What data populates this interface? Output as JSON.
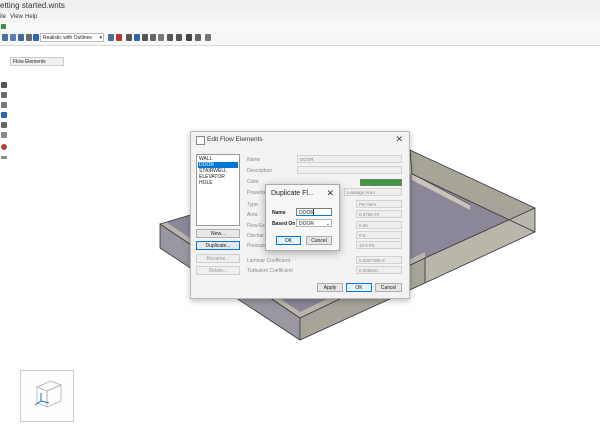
{
  "app": {
    "title": "etting started.wnts"
  },
  "menu": {
    "items": [
      "ile",
      "View",
      "Help"
    ]
  },
  "toolbar": {
    "render_mode": "Realistic with Outlines"
  },
  "panel": {
    "flow_elements_label": "Flow Elements"
  },
  "edit_dialog": {
    "title": "Edit Flow Elements",
    "list_items": [
      "WALL",
      "DOOR",
      "STAIRWELL",
      "ELEVATOR",
      "HOLE"
    ],
    "selected_index": 1,
    "buttons": {
      "new": "New...",
      "duplicate": "Duplicate...",
      "rename": "Rename...",
      "delete": "Delete..."
    },
    "props": {
      "name_label": "Name",
      "name_value": "DOOR",
      "description_label": "Description",
      "color_label": "Color",
      "powerlaw_label": "Powerla",
      "powerlaw_value": "Leakage Area",
      "type_label": "Type",
      "type_value": "Per Item",
      "area_label": "Area",
      "area_value": "0.0758 m²",
      "flowexp_label": "Flow Ex",
      "flowexp_value": "0.65",
      "discharge_label": "Dischar",
      "discharge_value": "0.6",
      "pressure_label": "Pressure",
      "pressure_value": "10.0 Pa",
      "laminar_label": "Laminar Coefficient",
      "laminar_value": "0.040748E-4",
      "turbulent_label": "Turbulent Coefficient",
      "turbulent_value": "0.048520"
    },
    "apply_label": "Apply",
    "ok_label": "OK",
    "cancel_label": "Cancel",
    "color": "#3c9a3c"
  },
  "duplicate_dialog": {
    "title": "Duplicate Fl...",
    "name_label": "Name",
    "name_value": "DOOR",
    "based_on_label": "Based On",
    "based_on_value": "DOOR",
    "ok_label": "OK",
    "cancel_label": "Cancel"
  },
  "colors": {
    "accent": "#0078d7",
    "wall": "#a9a8a2",
    "floor": "#8b8698"
  }
}
